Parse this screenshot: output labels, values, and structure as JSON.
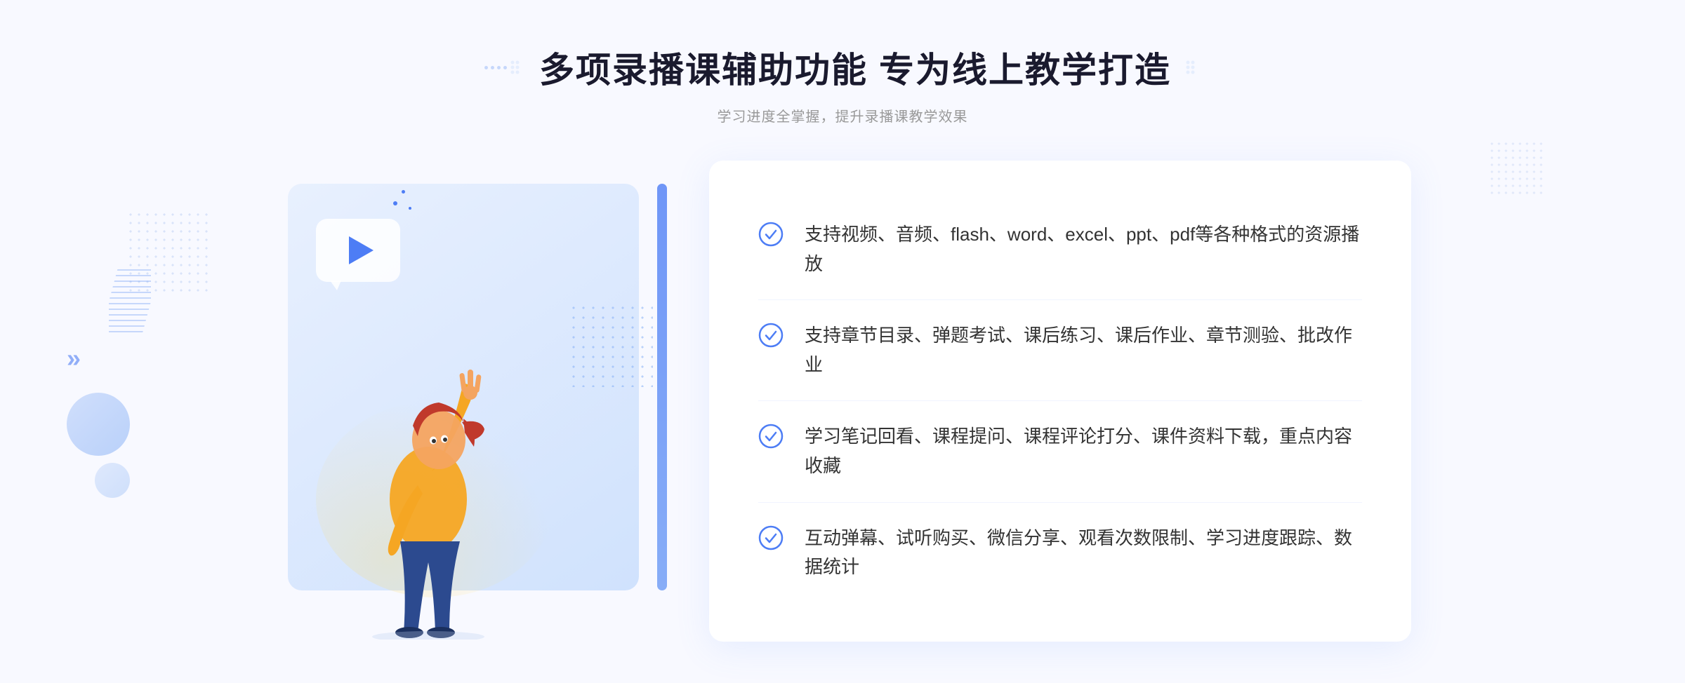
{
  "page": {
    "background_color": "#f5f7ff"
  },
  "header": {
    "title": "多项录播课辅助功能 专为线上教学打造",
    "subtitle": "学习进度全掌握，提升录播课教学效果",
    "title_left_deco": "decoration-left",
    "title_right_deco": "decoration-right"
  },
  "features": [
    {
      "id": 1,
      "text": "支持视频、音频、flash、word、excel、ppt、pdf等各种格式的资源播放"
    },
    {
      "id": 2,
      "text": "支持章节目录、弹题考试、课后练习、课后作业、章节测验、批改作业"
    },
    {
      "id": 3,
      "text": "学习笔记回看、课程提问、课程评论打分、课件资料下载，重点内容收藏"
    },
    {
      "id": 4,
      "text": "互动弹幕、试听购买、微信分享、观看次数限制、学习进度跟踪、数据统计"
    }
  ],
  "illustration": {
    "play_button_aria": "video play button",
    "figure_aria": "teaching illustration"
  },
  "colors": {
    "primary": "#4d7df5",
    "text_dark": "#1a1a2e",
    "text_light": "#999999",
    "text_body": "#333333",
    "bg_page": "#f5f7ff",
    "bg_card": "#ffffff",
    "bg_illustration": "#deeafd"
  }
}
